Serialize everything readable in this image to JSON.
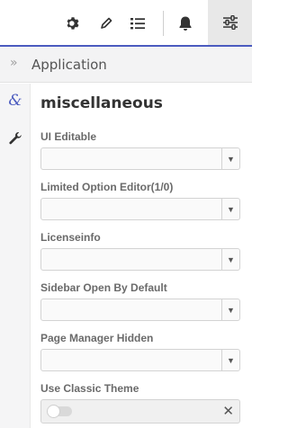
{
  "toolbar": {
    "icons": [
      "gear-icon",
      "pencil-icon",
      "list-icon",
      "bell-icon",
      "sliders-icon"
    ],
    "accent_color": "#4b5bbf"
  },
  "breadcrumb": {
    "arrow": "»",
    "label": "Application"
  },
  "rail": {
    "amp_symbol": "&"
  },
  "section": {
    "title": "miscellaneous"
  },
  "fields": [
    {
      "label": "UI Editable",
      "value": ""
    },
    {
      "label": "Limited Option Editor(1/0)",
      "value": ""
    },
    {
      "label": "Licenseinfo",
      "value": ""
    },
    {
      "label": "Sidebar Open By Default",
      "value": ""
    },
    {
      "label": "Page Manager Hidden",
      "value": ""
    },
    {
      "label": "Use Classic Theme",
      "value": "off"
    }
  ],
  "caret": "▼",
  "clear": "✕"
}
